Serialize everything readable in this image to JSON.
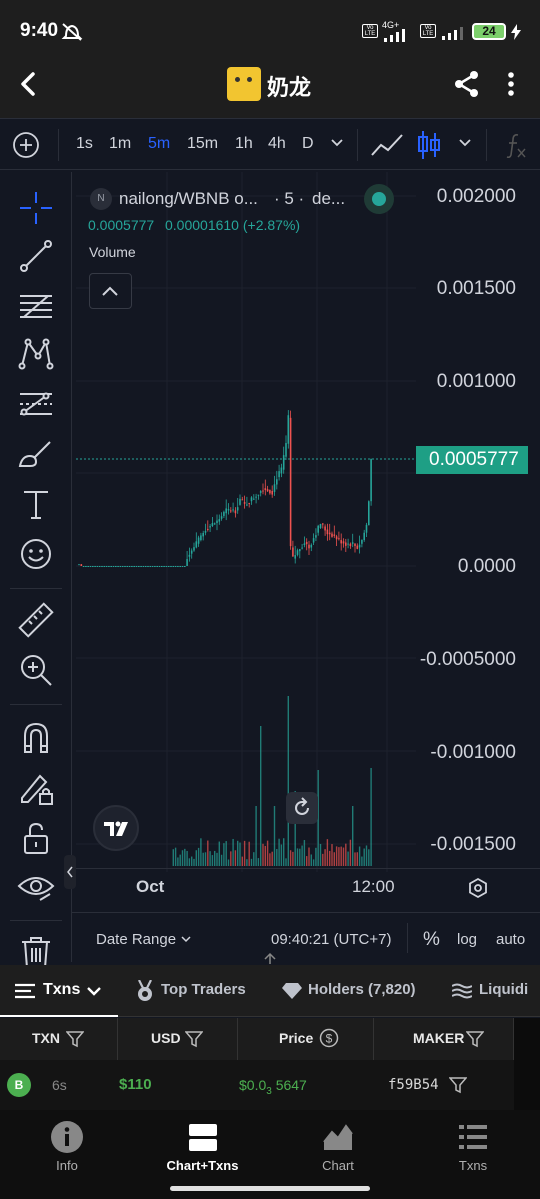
{
  "status": {
    "time": "9:40",
    "battery": "24",
    "network": "4G+"
  },
  "header": {
    "title": "奶龙"
  },
  "toolbar": {
    "timeframes": [
      "1s",
      "1m",
      "5m",
      "15m",
      "1h",
      "4h",
      "D"
    ],
    "active_timeframe": "5m"
  },
  "legend": {
    "symbol_badge": "N",
    "pair": "nailong/WBNB o...",
    "interval": "· 5 ·",
    "source": "de...",
    "price": "0.0005777",
    "change": "0.00001610 (+2.87%)",
    "volume_label": "Volume"
  },
  "price_axis": {
    "labels": [
      "0.002000",
      "0.001500",
      "0.001000",
      "0.0000",
      "-0.0005000",
      "-0.001000",
      "-0.001500"
    ],
    "current_price": "0.0005777"
  },
  "time_axis": {
    "labels": [
      "Oct",
      "12:00"
    ]
  },
  "chart_footer": {
    "date_range": "Date Range",
    "time": "09:40:21 (UTC+7)",
    "percent": "%",
    "log": "log",
    "auto": "auto"
  },
  "tabs": {
    "txns": "Txns",
    "top_traders": "Top Traders",
    "holders": "Holders (7,820)",
    "liquidity": "Liquidi"
  },
  "table": {
    "headers": {
      "txn": "TXN",
      "usd": "USD",
      "price": "Price",
      "maker": "MAKER"
    },
    "rows": [
      {
        "type": "B",
        "age": "6s",
        "usd": "$110",
        "price_prefix": "$0.0",
        "price_sub": "3",
        "price_rest": "5647",
        "maker": "f59B54"
      }
    ]
  },
  "bottom_nav": {
    "info": "Info",
    "chart_txns": "Chart+Txns",
    "chart": "Chart",
    "txns": "Txns"
  },
  "colors": {
    "up": "#26a69a",
    "down": "#ef5350",
    "accent_blue": "#2962ff",
    "buy_green": "#4caf50"
  }
}
